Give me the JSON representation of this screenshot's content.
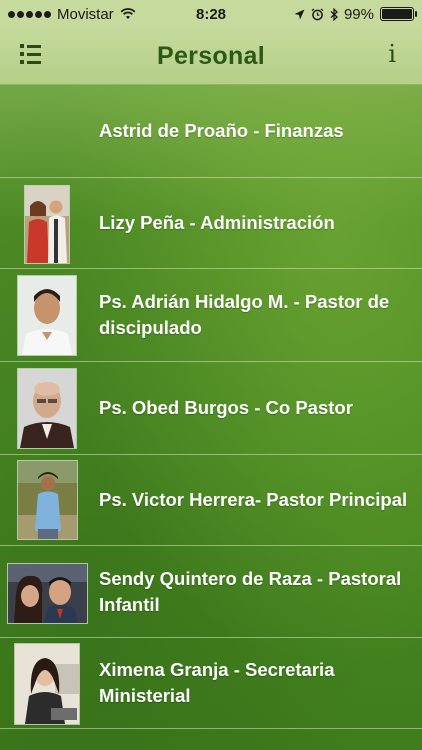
{
  "statusbar": {
    "carrier": "Movistar",
    "time": "8:28",
    "battery": "99%",
    "battery_level": 0.99
  },
  "navbar": {
    "title": "Personal",
    "info_label": "i"
  },
  "list": [
    {
      "text": "Astrid de Proaño - Finanzas"
    },
    {
      "text": "Lizy Peña - Administración"
    },
    {
      "text": "Ps. Adrián Hidalgo M. - Pastor de discipulado"
    },
    {
      "text": "Ps. Obed Burgos - Co Pastor"
    },
    {
      "text": "Ps. Victor Herrera- Pastor Principal"
    },
    {
      "text": "Sendy Quintero de Raza - Pastoral Infantil"
    },
    {
      "text": "Ximena Granja - Secretaria Ministerial"
    }
  ]
}
